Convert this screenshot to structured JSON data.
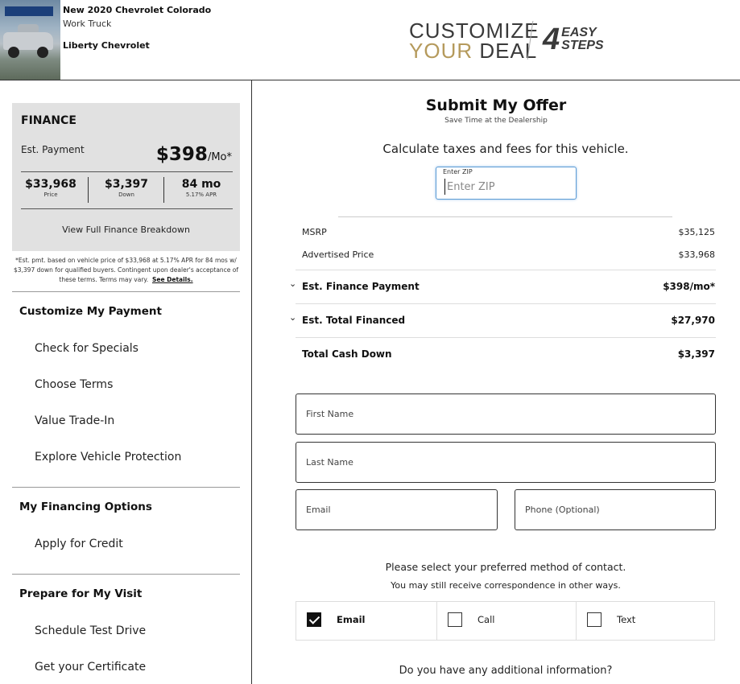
{
  "header": {
    "vehicle_title": "New 2020 Chevrolet Colorado",
    "vehicle_trim": "Work Truck",
    "dealer": "Liberty Chevrolet",
    "brand_line1": "CUSTOMIZE",
    "brand_your": "YOUR",
    "brand_deal": " DEAL",
    "steps_num": "4",
    "steps_word1": "EASY",
    "steps_word2": "STEPS",
    "colors": {
      "gold": "#b59a5c",
      "dark": "#3a3a3a"
    }
  },
  "finance": {
    "title": "FINANCE",
    "est_label": "Est. Payment",
    "est_amount": "$398",
    "est_unit": "/Mo*",
    "price": "$33,968",
    "price_label": "Price",
    "down": "$3,397",
    "down_label": "Down",
    "term": "84 mo",
    "apr_label": "5.17% APR",
    "view_full": "View Full Finance Breakdown",
    "disclaimer": "*Est. pmt. based on vehicle price of $33,968 at 5.17% APR for 84 mos w/ $3,397 down for qualified buyers. Contingent upon dealer's acceptance of these terms. Terms may vary.",
    "see_details": "See Details."
  },
  "nav": {
    "section1": "Customize My Payment",
    "items1": [
      "Check for Specials",
      "Choose Terms",
      "Value Trade-In",
      "Explore Vehicle Protection"
    ],
    "section2": "My Financing Options",
    "items2": [
      "Apply for Credit"
    ],
    "section3": "Prepare for My Visit",
    "items3": [
      "Schedule Test Drive",
      "Get your Certificate"
    ]
  },
  "offer": {
    "title": "Submit My Offer",
    "subtitle": "Save Time at the Dealership",
    "calc_text": "Calculate taxes and fees for this vehicle.",
    "zip_label": "Enter ZIP",
    "zip_placeholder": "Enter ZIP",
    "zip_value": "",
    "msrp_label": "MSRP",
    "msrp_value": "$35,125",
    "adv_label": "Advertised Price",
    "adv_value": "$33,968",
    "fin_pay_label": "Est. Finance Payment",
    "fin_pay_value": "$398/mo*",
    "total_fin_label": "Est. Total Financed",
    "total_fin_value": "$27,970",
    "cash_down_label": "Total Cash Down",
    "cash_down_value": "$3,397",
    "chevron": "⌄"
  },
  "form": {
    "first_name_placeholder": "First Name",
    "last_name_placeholder": "Last Name",
    "email_placeholder": "Email",
    "phone_placeholder": "Phone (Optional)",
    "pref_text": "Please select your preferred method of contact.",
    "pref_sub": "You may still receive correspondence in other ways.",
    "contact_email": "Email",
    "contact_call": "Call",
    "contact_text": "Text",
    "email_checked": true,
    "additional": "Do you have any additional information?"
  }
}
